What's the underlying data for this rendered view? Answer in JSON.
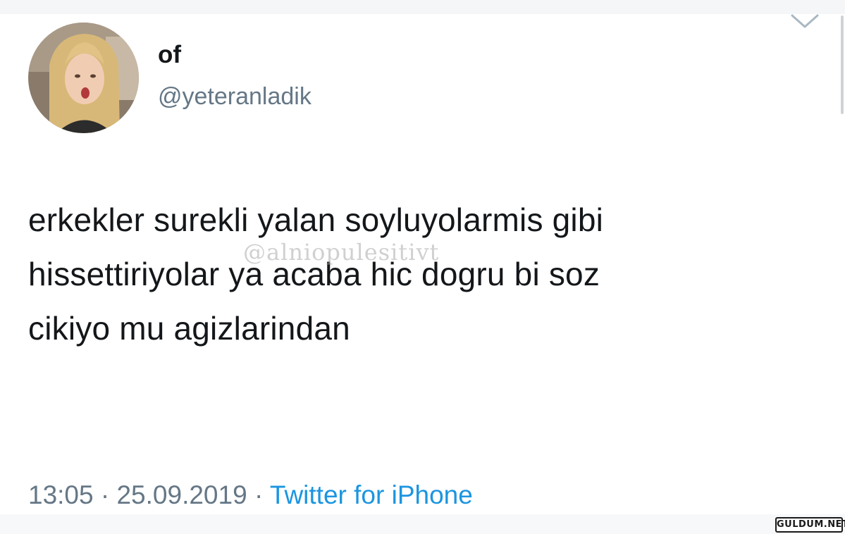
{
  "tweet": {
    "display_name": "of",
    "handle": "@yeteranladik",
    "text_lines": [
      "erkekler surekli yalan soyluyolarmis gibi",
      "hissettiriyolar ya acaba hic dogru bi soz",
      "cikiyo mu agizlarindan"
    ],
    "time": "13:05",
    "separator": "·",
    "date": "25.09.2019",
    "source": "Twitter for iPhone"
  },
  "watermark": "@alniopulesitivt",
  "site_logo": "GULDUM.NET",
  "icons": {
    "menu": "chevron-down-icon",
    "avatar": "avatar"
  },
  "colors": {
    "text_primary": "#14171a",
    "text_secondary": "#657786",
    "link": "#1b95e0"
  }
}
